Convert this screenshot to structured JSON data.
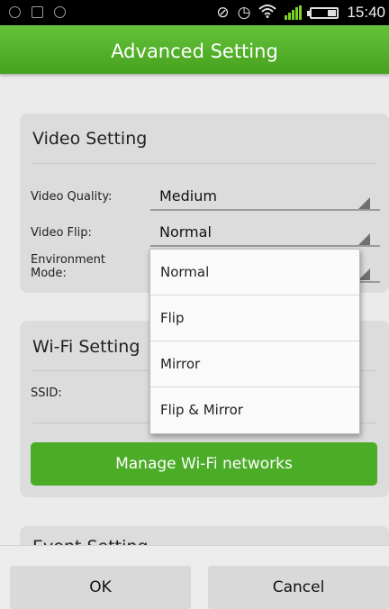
{
  "status_bar": {
    "left_icons": [
      "notification-icon",
      "image-icon",
      "notification-icon"
    ],
    "right_icons": [
      "mute-icon",
      "alarm-icon",
      "wifi-icon",
      "signal-icon",
      "battery-icon"
    ],
    "time": "15:40"
  },
  "header": {
    "title": "Advanced Setting"
  },
  "video_setting": {
    "title": "Video Setting",
    "rows": [
      {
        "label": "Video Quality:",
        "value": "Medium"
      },
      {
        "label": "Video Flip:",
        "value": "Normal"
      },
      {
        "label": "Environment Mode:",
        "value": ""
      }
    ]
  },
  "wifi_setting": {
    "title": "Wi-Fi Setting",
    "ssid_label": "SSID:",
    "manage_button": "Manage Wi-Fi networks"
  },
  "event_setting": {
    "title": "Event Setting"
  },
  "dropdown": {
    "options": [
      "Normal",
      "Flip",
      "Mirror",
      "Flip & Mirror"
    ],
    "selected": "Normal"
  },
  "footer": {
    "ok": "OK",
    "cancel": "Cancel"
  },
  "colors": {
    "accent": "#4bac27",
    "header_top": "#63c23a",
    "card": "#dcdcdc"
  }
}
